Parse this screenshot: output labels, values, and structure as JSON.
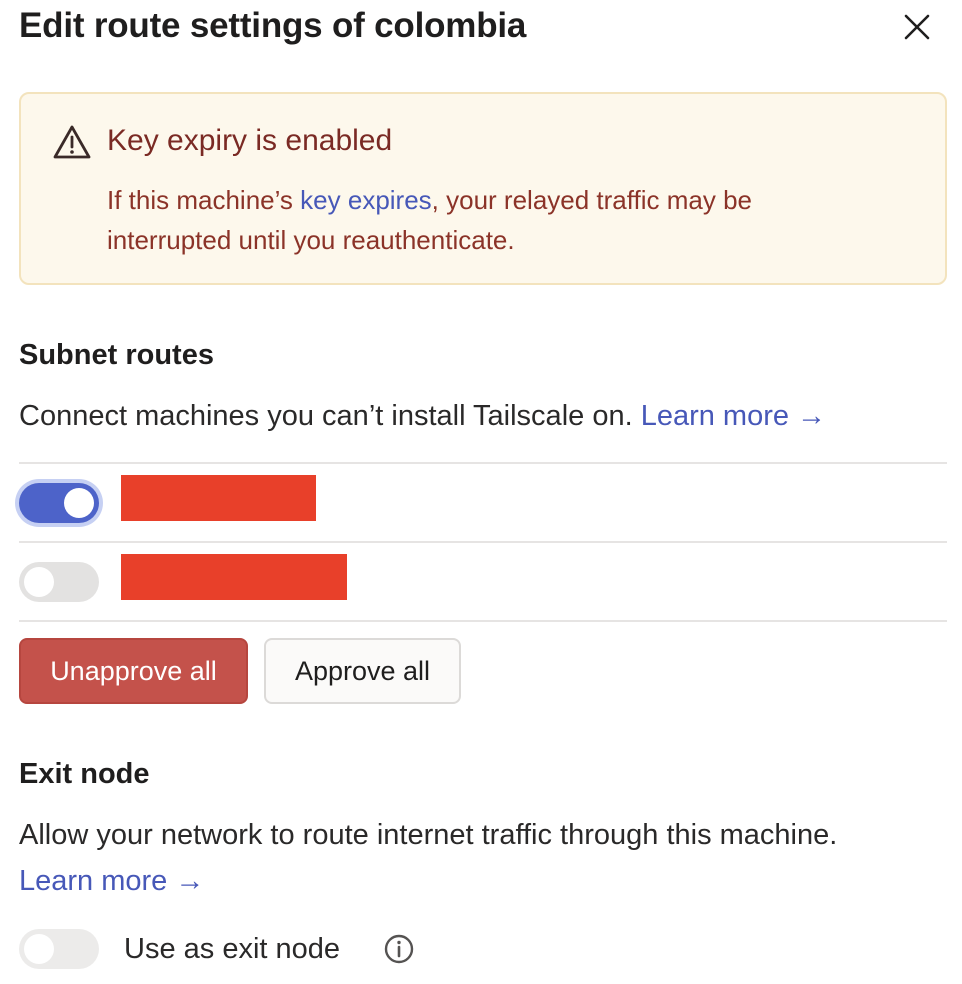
{
  "dialog": {
    "title": "Edit route settings of colombia",
    "close_icon": "close-icon"
  },
  "alert": {
    "icon": "warning-icon",
    "title": "Key expiry is enabled",
    "body_before": "If this machine’s ",
    "body_link": "key expires",
    "body_after": ", your relayed traffic may be interrupted until you reauthenticate."
  },
  "subnet": {
    "title": "Subnet routes",
    "description": "Connect machines you can’t install Tailscale on. ",
    "learn_more": "Learn more →",
    "routes": [
      {
        "enabled": true
      },
      {
        "enabled": false
      }
    ],
    "unapprove_label": "Unapprove all",
    "approve_label": "Approve all"
  },
  "exit_node": {
    "title": "Exit node",
    "description": "Allow your network to route internet traffic through this machine. ",
    "learn_more": "Learn more →",
    "toggle_enabled": false,
    "toggle_label": "Use as exit node",
    "info_icon": "info-icon"
  },
  "colors": {
    "accent": "#4d63c9",
    "danger": "#c4524b",
    "redaction": "#e8402a",
    "alert_bg": "#fdf8ec",
    "alert_text": "#8b3328",
    "link": "#4758b8"
  }
}
